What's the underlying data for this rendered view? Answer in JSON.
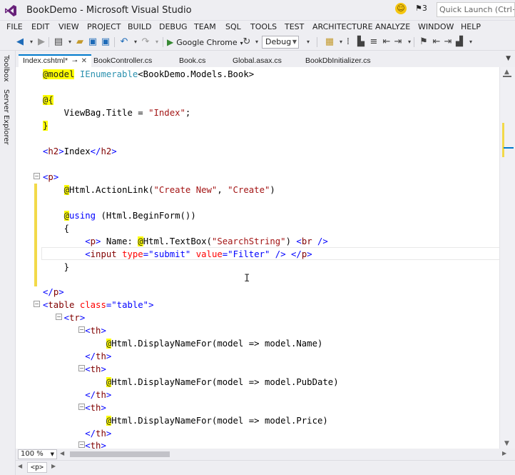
{
  "window": {
    "title": "BookDemo - Microsoft Visual Studio",
    "notification_count": "3",
    "quick_launch_placeholder": "Quick Launch (Ctrl+Q)"
  },
  "menu": [
    "FILE",
    "EDIT",
    "VIEW",
    "PROJECT",
    "BUILD",
    "DEBUG",
    "TEAM",
    "SQL",
    "TOOLS",
    "TEST",
    "ARCHITECTURE",
    "ANALYZE",
    "WINDOW",
    "HELP"
  ],
  "toolbar": {
    "run_target": "Google Chrome",
    "configuration": "Debug"
  },
  "side_tabs": [
    "Toolbox",
    "Server Explorer"
  ],
  "tabs": [
    {
      "label": "Index.cshtml*",
      "active": true
    },
    {
      "label": "BookController.cs",
      "active": false
    },
    {
      "label": "Book.cs",
      "active": false
    },
    {
      "label": "Global.asax.cs",
      "active": false
    },
    {
      "label": "BookDbInitializer.cs",
      "active": false
    }
  ],
  "code": {
    "l1_razor": "@model",
    "l1_type": "IEnumerable",
    "l1_rest": "<BookDemo.Models.Book>",
    "l2_razor": "@{",
    "l3_prop": "ViewBag.Title = ",
    "l3_str": "\"Index\"",
    "l3_end": ";",
    "l4_razor": "}",
    "l5_open": "<",
    "l5_tag": "h2",
    "l5_close": ">",
    "l5_text": "Index",
    "l5_open2": "</",
    "l5_tag2": "h2",
    "l5_close2": ">",
    "l6_open": "<",
    "l6_tag": "p",
    "l6_close": ">",
    "l7_razor": "@",
    "l7_call": "Html.ActionLink(",
    "l7_str1": "\"Create New\"",
    "l7_comma": ", ",
    "l7_str2": "\"Create\"",
    "l7_end": ")",
    "l8_razor": "@",
    "l8_kw": "using",
    "l8_rest": " (Html.BeginForm())",
    "l9_brace": "{",
    "l10_open": "<",
    "l10_tag": "p",
    "l10_close": ">",
    "l10_text": " Name: ",
    "l10_razor": "@",
    "l10_call": "Html.TextBox(",
    "l10_str": "\"SearchString\"",
    "l10_end": ") ",
    "l10_br_open": "<",
    "l10_br": "br",
    "l10_br_close": " />",
    "l11_open": "<",
    "l11_tag": "input",
    "l11_attr1": " type",
    "l11_eq1": "=",
    "l11_val1": "\"submit\"",
    "l11_attr2": " value",
    "l11_eq2": "=",
    "l11_val2": "\"Filter\"",
    "l11_sc": " /> ",
    "l11_end_open": "</",
    "l11_end_tag": "p",
    "l11_end_close": ">",
    "l12_brace": "}",
    "l13_open": "</",
    "l13_tag": "p",
    "l13_close": ">",
    "l14_open": "<",
    "l14_tag": "table",
    "l14_attr": " class",
    "l14_eq": "=",
    "l14_val": "\"table\"",
    "l14_close": ">",
    "l15_open": "<",
    "l15_tag": "tr",
    "l15_close": ">",
    "th_open": "<",
    "th_tag": "th",
    "th_close": ">",
    "th_end_open": "</",
    "th_razor": "@",
    "dn_call": "Html.DisplayNameFor(model => model.",
    "dn_name": "Name)",
    "dn_pubdate": "PubDate)",
    "dn_price": "Price)"
  },
  "status": {
    "zoom": "100 %",
    "breadcrumb": "<p>"
  }
}
